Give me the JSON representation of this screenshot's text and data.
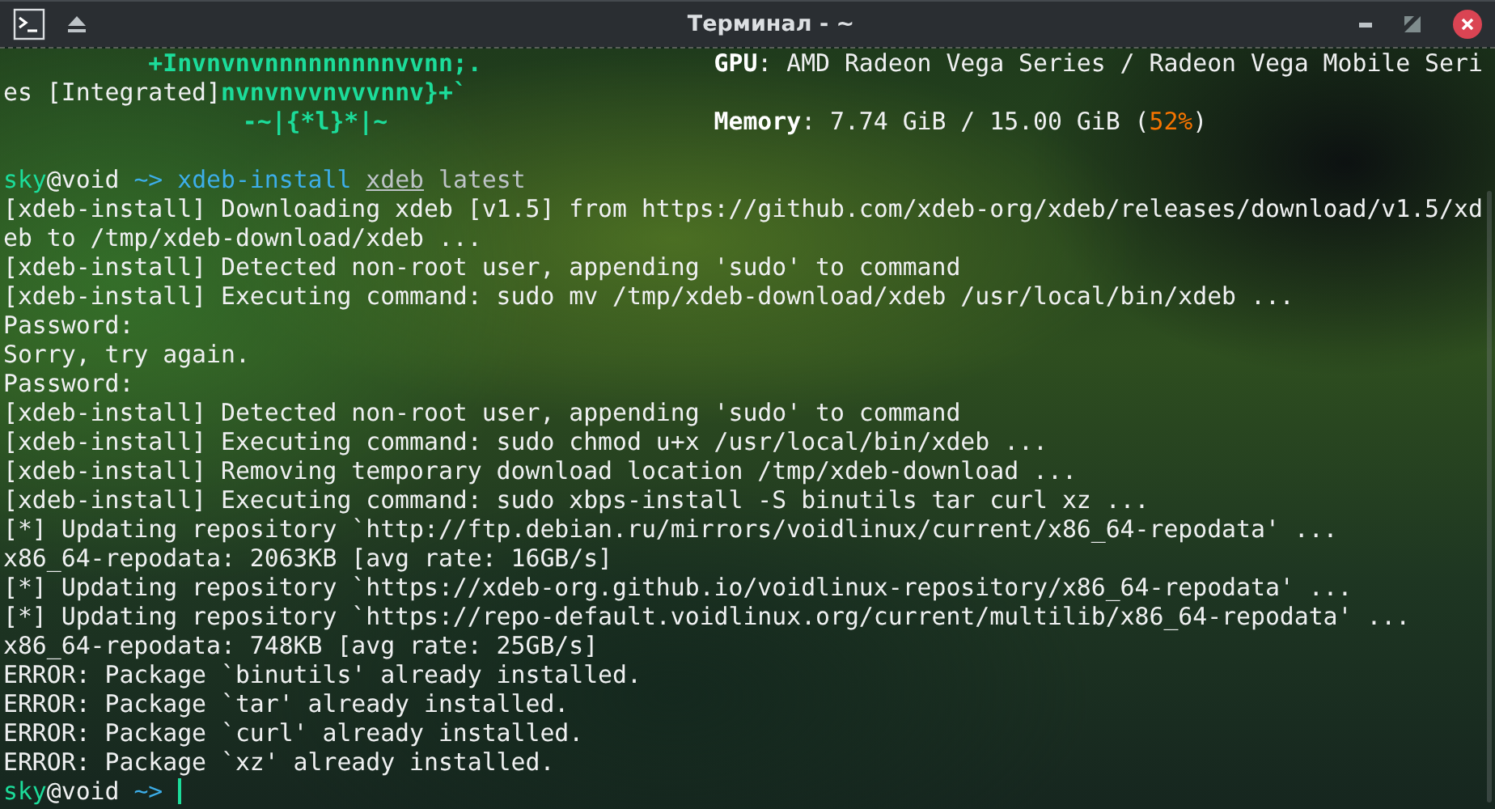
{
  "window": {
    "title": "Терминал - ~"
  },
  "lines": [
    {
      "kind": "info",
      "logo": [
        {
          "text": "+Invnvnvnnnnnnnnnvvnn;.",
          "kind": "logo"
        }
      ],
      "segments": [
        {
          "text": "GPU",
          "kind": "label"
        },
        {
          "text": ": AMD Radeon Vega Series / Radeon Vega Mobile Seri",
          "kind": "plain"
        }
      ]
    },
    {
      "kind": "output",
      "segments": [
        {
          "text": "es [Integrated]",
          "kind": "plain"
        },
        {
          "text": "nvnvnvvnvvvnnv}+`",
          "kind": "logo"
        }
      ]
    },
    {
      "kind": "info",
      "logo": [
        {
          "text": "-~|{*l}*|~",
          "kind": "logo"
        }
      ],
      "segments": [
        {
          "text": "Memory",
          "kind": "label"
        },
        {
          "text": ": 7.74 GiB / 15.00 GiB (",
          "kind": "plain"
        },
        {
          "text": "52%",
          "kind": "percent"
        },
        {
          "text": ")",
          "kind": "plain"
        }
      ]
    },
    {
      "kind": "blank"
    },
    {
      "kind": "prompt",
      "segments": [
        {
          "text": "sky",
          "kind": "user"
        },
        {
          "text": "@void ",
          "kind": "plain"
        },
        {
          "text": "~> ",
          "kind": "path"
        },
        {
          "text": "xdeb-install ",
          "kind": "command"
        },
        {
          "text": "xdeb",
          "kind": "arg"
        },
        {
          "text": " latest",
          "kind": "param"
        }
      ]
    },
    {
      "kind": "output",
      "segments": [
        {
          "text": "[xdeb-install] Downloading xdeb [v1.5] from https://github.com/xdeb-org/xdeb/releases/download/v1.5/xd",
          "kind": "plain"
        }
      ]
    },
    {
      "kind": "output",
      "segments": [
        {
          "text": "eb to /tmp/xdeb-download/xdeb ...",
          "kind": "plain"
        }
      ]
    },
    {
      "kind": "output",
      "segments": [
        {
          "text": "[xdeb-install] Detected non-root user, appending 'sudo' to command",
          "kind": "plain"
        }
      ]
    },
    {
      "kind": "output",
      "segments": [
        {
          "text": "[xdeb-install] Executing command: sudo mv /tmp/xdeb-download/xdeb /usr/local/bin/xdeb ...",
          "kind": "plain"
        }
      ]
    },
    {
      "kind": "output",
      "segments": [
        {
          "text": "Password:",
          "kind": "plain"
        }
      ]
    },
    {
      "kind": "output",
      "segments": [
        {
          "text": "Sorry, try again.",
          "kind": "plain"
        }
      ]
    },
    {
      "kind": "output",
      "segments": [
        {
          "text": "Password:",
          "kind": "plain"
        }
      ]
    },
    {
      "kind": "output",
      "segments": [
        {
          "text": "[xdeb-install] Detected non-root user, appending 'sudo' to command",
          "kind": "plain"
        }
      ]
    },
    {
      "kind": "output",
      "segments": [
        {
          "text": "[xdeb-install] Executing command: sudo chmod u+x /usr/local/bin/xdeb ...",
          "kind": "plain"
        }
      ]
    },
    {
      "kind": "output",
      "segments": [
        {
          "text": "[xdeb-install] Removing temporary download location /tmp/xdeb-download ...",
          "kind": "plain"
        }
      ]
    },
    {
      "kind": "output",
      "segments": [
        {
          "text": "[xdeb-install] Executing command: sudo xbps-install -S binutils tar curl xz ...",
          "kind": "plain"
        }
      ]
    },
    {
      "kind": "output",
      "segments": [
        {
          "text": "[*] Updating repository `http://ftp.debian.ru/mirrors/voidlinux/current/x86_64-repodata' ...",
          "kind": "plain"
        }
      ]
    },
    {
      "kind": "output",
      "segments": [
        {
          "text": "x86_64-repodata: 2063KB [avg rate: 16GB/s]",
          "kind": "plain"
        }
      ]
    },
    {
      "kind": "output",
      "segments": [
        {
          "text": "[*] Updating repository `https://xdeb-org.github.io/voidlinux-repository/x86_64-repodata' ...",
          "kind": "plain"
        }
      ]
    },
    {
      "kind": "output",
      "segments": [
        {
          "text": "[*] Updating repository `https://repo-default.voidlinux.org/current/multilib/x86_64-repodata' ...",
          "kind": "plain"
        }
      ]
    },
    {
      "kind": "output",
      "segments": [
        {
          "text": "x86_64-repodata: 748KB [avg rate: 25GB/s]",
          "kind": "plain"
        }
      ]
    },
    {
      "kind": "output",
      "segments": [
        {
          "text": "ERROR: Package `binutils' already installed.",
          "kind": "plain"
        }
      ]
    },
    {
      "kind": "output",
      "segments": [
        {
          "text": "ERROR: Package `tar' already installed.",
          "kind": "plain"
        }
      ]
    },
    {
      "kind": "output",
      "segments": [
        {
          "text": "ERROR: Package `curl' already installed.",
          "kind": "plain"
        }
      ]
    },
    {
      "kind": "output",
      "segments": [
        {
          "text": "ERROR: Package `xz' already installed.",
          "kind": "plain"
        }
      ]
    },
    {
      "kind": "prompt",
      "cursor": true,
      "segments": [
        {
          "text": "sky",
          "kind": "user"
        },
        {
          "text": "@void ",
          "kind": "plain"
        },
        {
          "text": "~> ",
          "kind": "path"
        }
      ]
    }
  ]
}
